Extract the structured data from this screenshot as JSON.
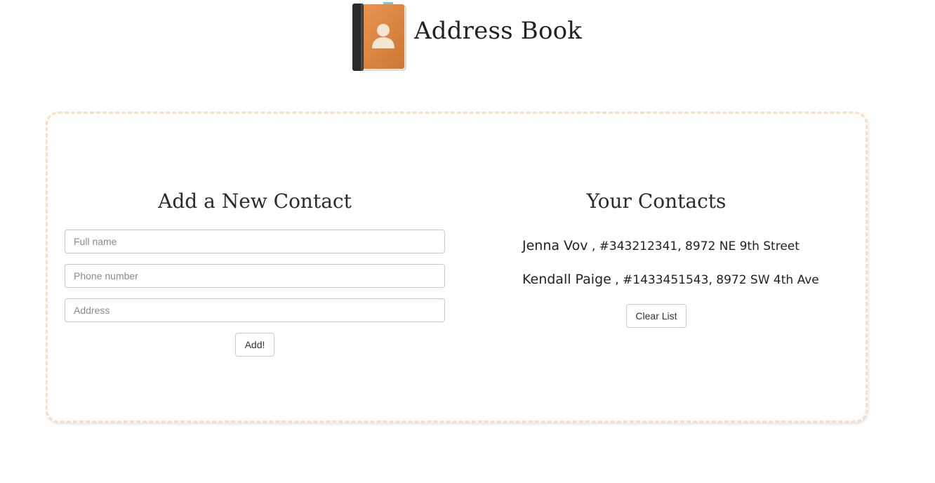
{
  "header": {
    "title": "Address Book",
    "logo_icon": "address-book-icon"
  },
  "add_contact": {
    "title": "Add a New Contact",
    "name_placeholder": "Full name",
    "phone_placeholder": "Phone number",
    "address_placeholder": "Address",
    "name_value": "",
    "phone_value": "",
    "address_value": "",
    "add_label": "Add!"
  },
  "contacts": {
    "title": "Your Contacts",
    "items": [
      {
        "name": "Jenna Vov",
        "details": " , #343212341, 8972 NE 9th Street"
      },
      {
        "name": "Kendall Paige",
        "details": " , #1433451543, 8972 SW 4th Ave"
      }
    ],
    "clear_label": "Clear List"
  },
  "colors": {
    "panel_border": "#f7dfbf",
    "book_cover": "#e8873a",
    "book_spine": "#2a2a2a"
  }
}
